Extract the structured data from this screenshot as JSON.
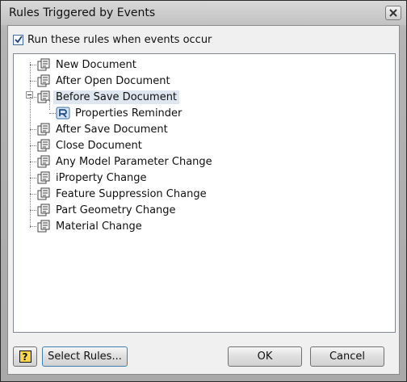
{
  "window": {
    "title": "Rules Triggered by Events"
  },
  "run_option": {
    "label": "Run these rules when events occur",
    "checked": true
  },
  "tree": {
    "items": [
      {
        "label": "New Document"
      },
      {
        "label": "After Open Document"
      },
      {
        "label": "Before Save Document",
        "expanded": true,
        "selected": true,
        "children": [
          {
            "label": "Properties Reminder"
          }
        ]
      },
      {
        "label": "After Save Document"
      },
      {
        "label": "Close Document"
      },
      {
        "label": "Any Model Parameter Change"
      },
      {
        "label": "iProperty Change"
      },
      {
        "label": "Feature Suppression Change"
      },
      {
        "label": "Part Geometry Change"
      },
      {
        "label": "Material Change"
      }
    ]
  },
  "buttons": {
    "help_label": "?",
    "select_rules": "Select Rules...",
    "ok": "OK",
    "cancel": "Cancel"
  },
  "colors": {
    "selection": "#dfe6ef",
    "accent": "#3c7fb1"
  }
}
